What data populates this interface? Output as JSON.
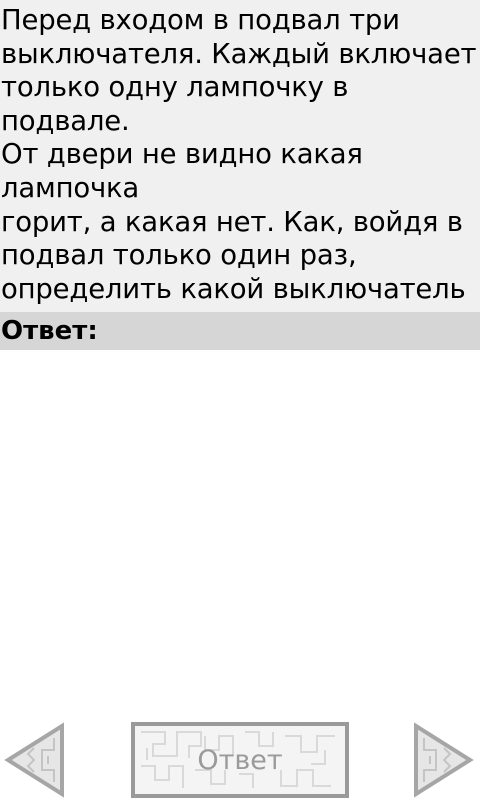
{
  "question": {
    "text": "Перед входом в подвал три\nвыключателя. Каждый включает\nтолько одну лампочку в подвале.\nОт двери не видно какая лампочка\nгорит, а какая нет. Как, войдя в\nподвал только один раз,\nопределить какой выключатель от\nкакой лампочки?"
  },
  "answer": {
    "header_label": "Ответ:",
    "content": ""
  },
  "navigation": {
    "prev_icon": "left-arrow-icon",
    "next_icon": "right-arrow-icon",
    "answer_button_label": "Ответ"
  },
  "colors": {
    "question_bg": "#f0f0f0",
    "answer_header_bg": "#d6d6d6",
    "control_gray": "#9a9a9a"
  }
}
